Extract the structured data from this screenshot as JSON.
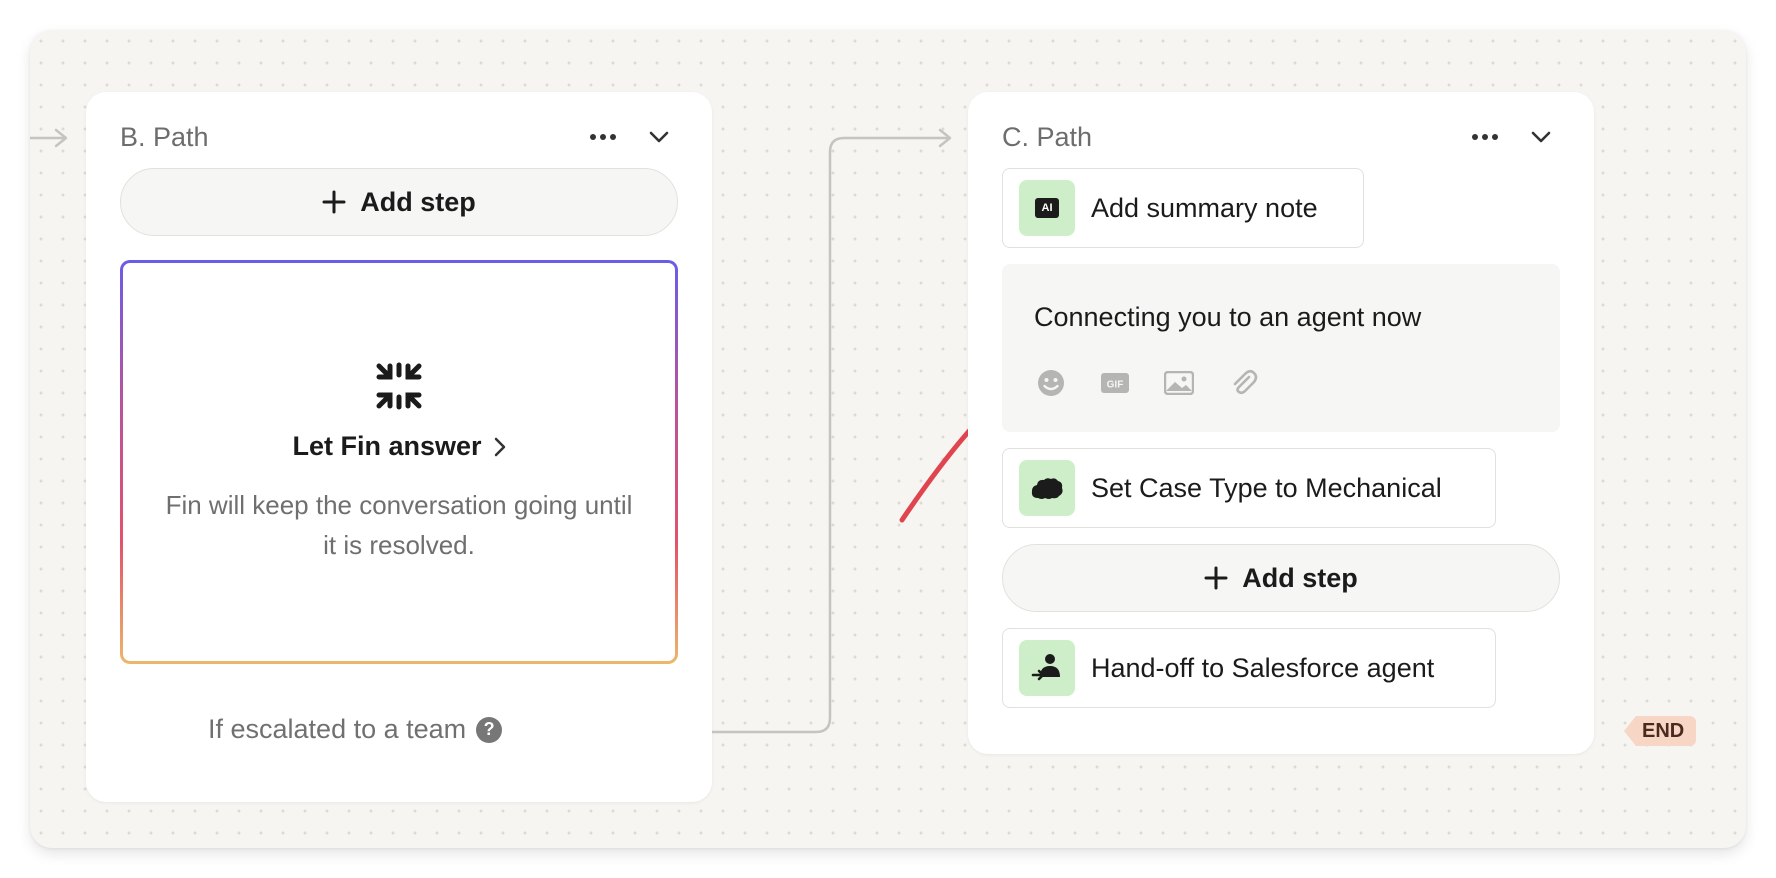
{
  "path_b": {
    "title": "B. Path",
    "add_step_label": "Add step",
    "fin_block": {
      "heading": "Let Fin answer",
      "description": "Fin will keep the conversation going until it is resolved."
    },
    "escalation_label": "If escalated to a team",
    "help_glyph": "?"
  },
  "path_c": {
    "title": "C. Path",
    "steps": {
      "summary": {
        "label": "Add summary note",
        "icon_badge": "AI"
      },
      "message": {
        "text": "Connecting you to an agent now"
      },
      "case_type": {
        "attribute": "Set Case Type",
        "value_text": "to Mechanical"
      },
      "handoff": {
        "label": "Hand-off to Salesforce agent"
      }
    },
    "add_step_label": "Add step",
    "message_tools": [
      "emoji-icon",
      "gif-icon",
      "image-icon",
      "attachment-icon"
    ],
    "gif_text": "GIF"
  },
  "end_tag": "END",
  "colors": {
    "canvas": "#f6f5f1",
    "step_icon_bg": "#cdeec8",
    "annotation_arrow": "#e0454f",
    "end_tag_bg": "#f8d6c6",
    "connector": "#c4c4c0"
  },
  "icons": {
    "fin": "fin-logo-icon",
    "salesforce": "salesforce-cloud-icon",
    "handoff": "handoff-agent-icon"
  }
}
